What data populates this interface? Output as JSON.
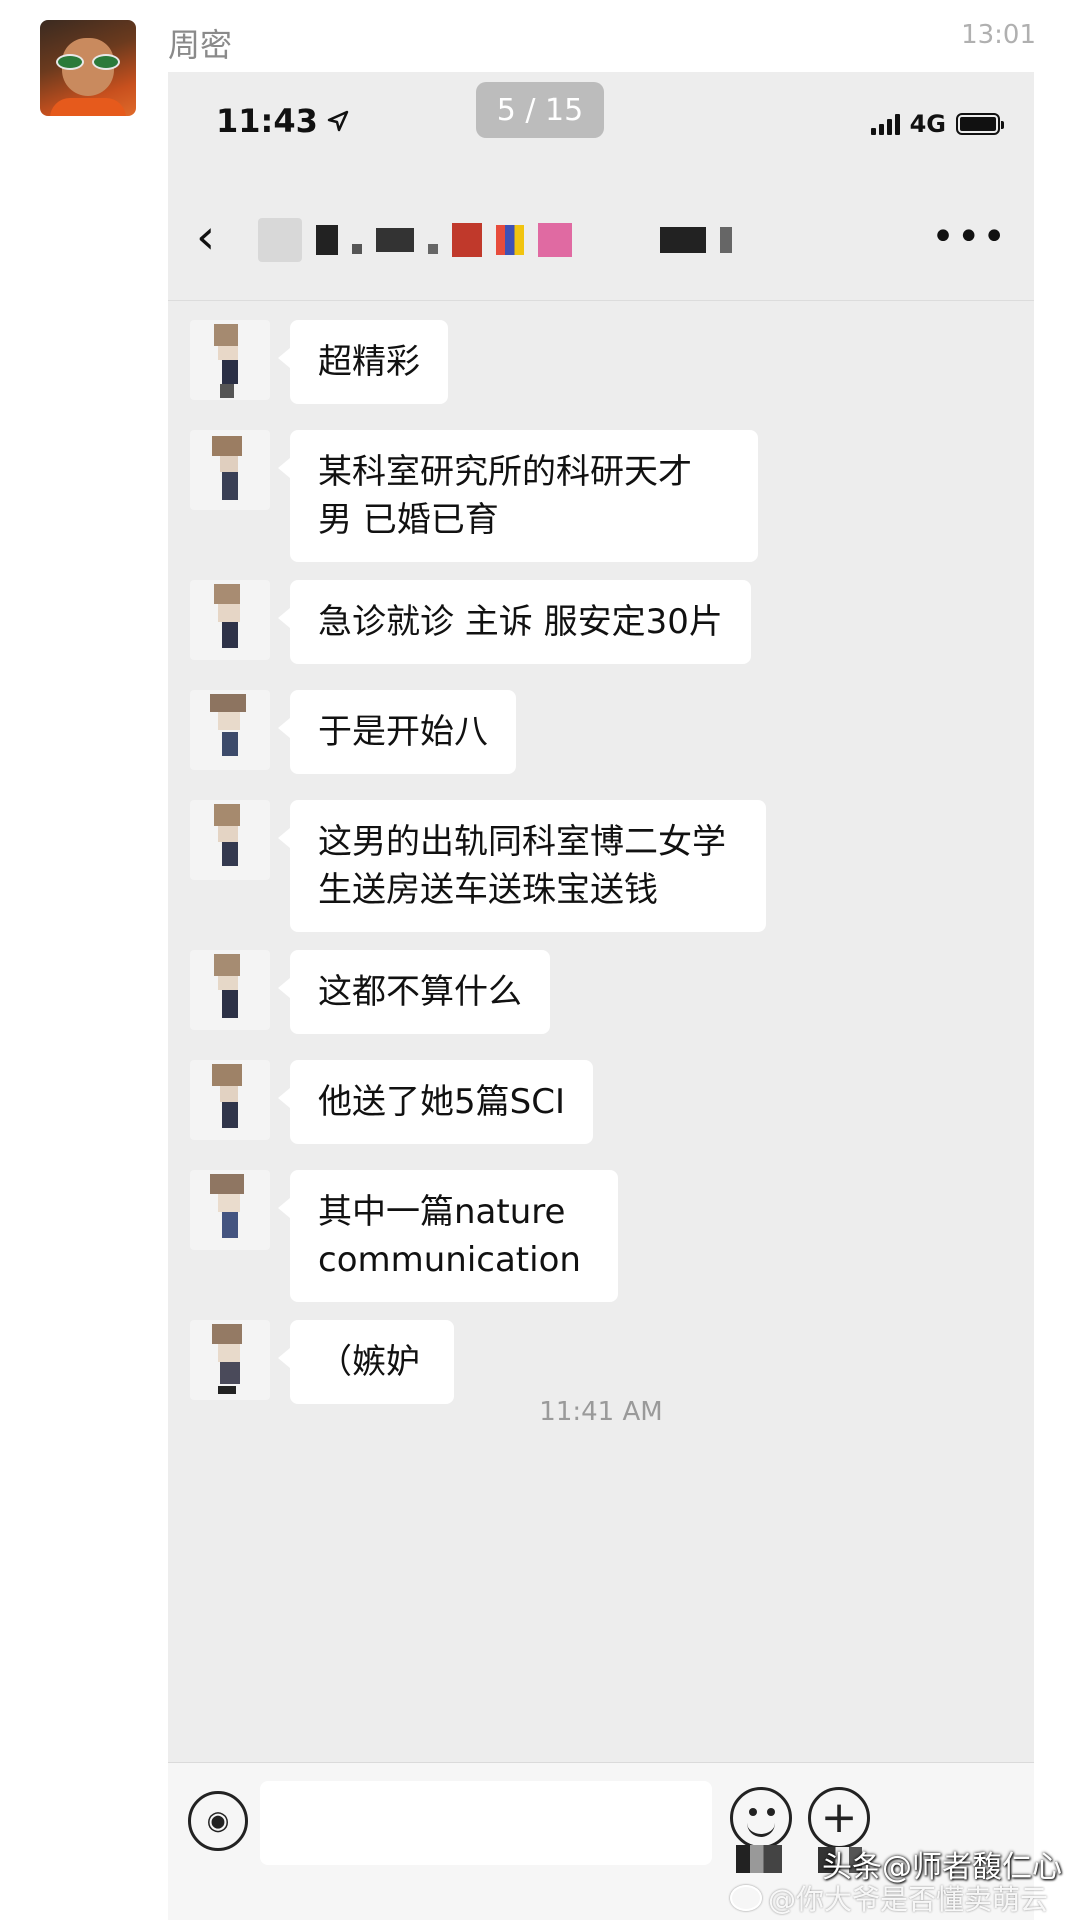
{
  "post": {
    "author_name": "周密",
    "time": "13:01"
  },
  "status_bar": {
    "time": "11:43",
    "network": "4G"
  },
  "viewer": {
    "page_counter": "5 / 15"
  },
  "messages": [
    {
      "text": "超精彩"
    },
    {
      "text": "某科室研究所的科研天才 男 已婚已育"
    },
    {
      "text": "急诊就诊 主诉 服安定30片"
    },
    {
      "text": "于是开始八"
    },
    {
      "text": "这男的出轨同科室博二女学生送房送车送珠宝送钱"
    },
    {
      "text": "这都不算什么"
    },
    {
      "text": "他送了她5篇SCI"
    },
    {
      "text": "其中一篇nature communication"
    },
    {
      "text": "（嫉妒"
    }
  ],
  "timestamp": "11:41 AM",
  "input_bar": {
    "placeholder": ""
  },
  "watermarks": {
    "primary": "头条@师者馥仁心",
    "secondary": "@你大爷是否懂卖萌云"
  },
  "icons": {
    "back": "chevron-left-icon",
    "more": "more-icon",
    "voice": "voice-icon",
    "emoji": "emoji-icon",
    "plus": "plus-icon",
    "location": "location-arrow-icon"
  }
}
